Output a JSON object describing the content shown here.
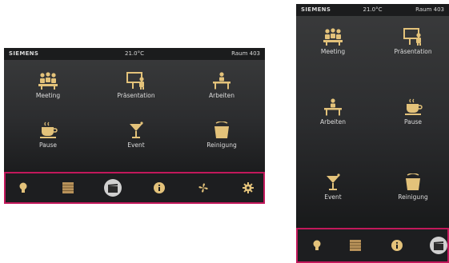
{
  "colors": {
    "accent_border": "#c2185b",
    "icon_gold": "#e3c27a",
    "panel_bg": "#2c2d2f"
  },
  "statusbar": {
    "brand": "SIEMENS",
    "temperature": "21.0°C",
    "room": "Raum 403"
  },
  "statusbar_portrait": {
    "brand": "SIEMENS",
    "temperature": "21.0°C",
    "room": "Raum 403"
  },
  "landscape": {
    "scenes": [
      {
        "label": "Meeting",
        "icon": "meeting-icon"
      },
      {
        "label": "Präsentation",
        "icon": "presentation-icon"
      },
      {
        "label": "Arbeiten",
        "icon": "desk-icon"
      },
      {
        "label": "Pause",
        "icon": "coffee-cup-icon"
      },
      {
        "label": "Event",
        "icon": "cocktail-icon"
      },
      {
        "label": "Reinigung",
        "icon": "bucket-icon"
      }
    ],
    "nav": [
      {
        "icon": "light-bulb-icon",
        "active": false
      },
      {
        "icon": "blinds-icon",
        "active": false
      },
      {
        "icon": "scene-icon",
        "active": true
      },
      {
        "icon": "info-icon",
        "active": false
      },
      {
        "icon": "fan-icon",
        "active": false
      },
      {
        "icon": "settings-gear-icon",
        "active": false
      }
    ]
  },
  "portrait": {
    "scenes": [
      {
        "label": "Meeting",
        "icon": "meeting-icon"
      },
      {
        "label": "Präsentation",
        "icon": "presentation-icon"
      },
      {
        "label": "Arbeiten",
        "icon": "desk-icon"
      },
      {
        "label": "Pause",
        "icon": "coffee-cup-icon"
      },
      {
        "label": "Event",
        "icon": "cocktail-icon"
      },
      {
        "label": "Reinigung",
        "icon": "bucket-icon"
      }
    ],
    "nav": [
      {
        "icon": "light-bulb-icon",
        "active": false
      },
      {
        "icon": "blinds-icon",
        "active": false
      },
      {
        "icon": "info-icon",
        "active": false
      },
      {
        "icon": "scene-icon",
        "active": true
      }
    ]
  }
}
